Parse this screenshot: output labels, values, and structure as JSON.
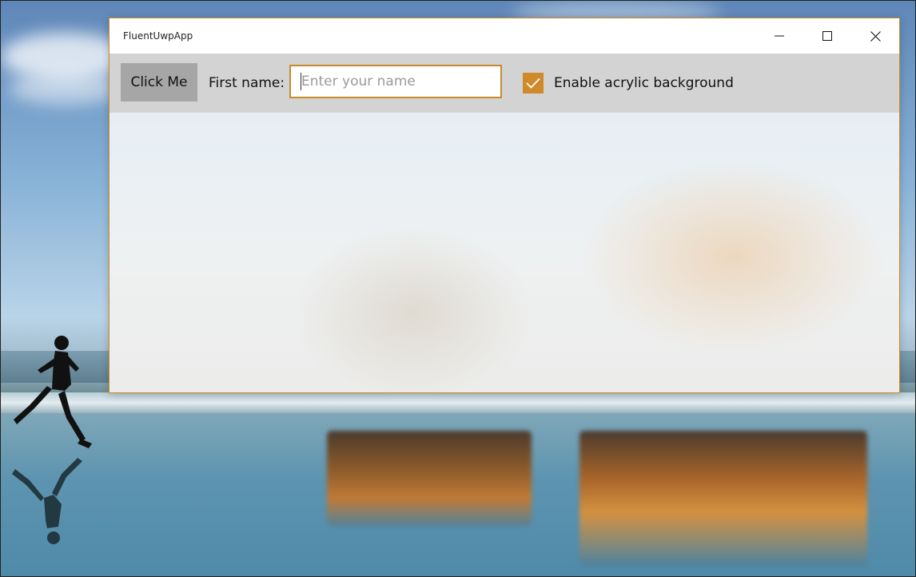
{
  "window": {
    "title": "FluentUwpApp",
    "accent_color": "#d08a2c"
  },
  "caption_buttons": {
    "minimize_icon": "minimize-icon",
    "maximize_icon": "maximize-icon",
    "close_icon": "close-icon"
  },
  "toolbar": {
    "click_button_label": "Click Me",
    "first_name_label": "First name:",
    "name_input": {
      "value": "",
      "placeholder": "Enter your name"
    },
    "acrylic_checkbox": {
      "label": "Enable acrylic background",
      "checked": true
    }
  }
}
